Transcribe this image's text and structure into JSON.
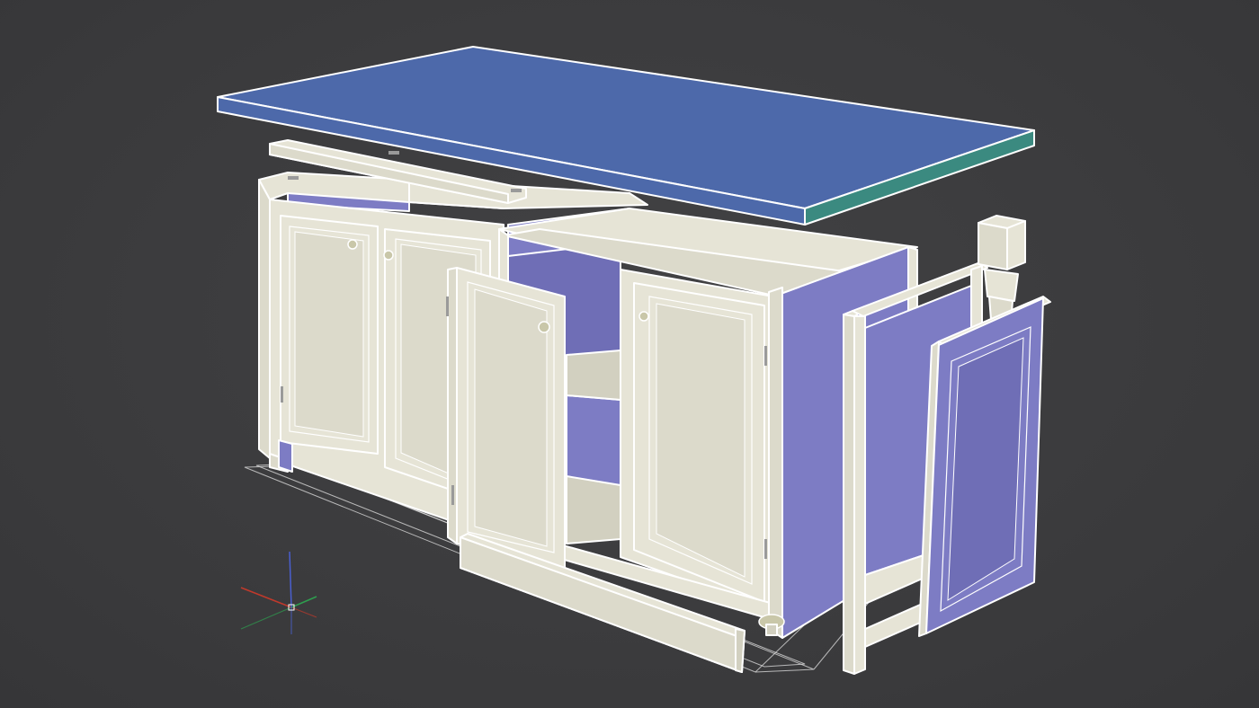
{
  "viewport": {
    "background": "#3b3b3d",
    "shading_mode": "edged-faces"
  },
  "model": {
    "parts": [
      {
        "name": "countertop",
        "color": "#4d69aa",
        "edge_color": "#3b8a80"
      },
      {
        "name": "cabinet-body",
        "color": "#e6e4d6"
      },
      {
        "name": "interior-panels",
        "color": "#7d7cc4"
      },
      {
        "name": "open-door",
        "color": "#e6e4d6"
      },
      {
        "name": "side-door-frame",
        "color": "#e6e4d6"
      },
      {
        "name": "side-door-panel",
        "color": "#7d7cc4"
      },
      {
        "name": "toe-kick",
        "color": "#e6e4d6"
      },
      {
        "name": "corner-leg-post",
        "color": "#e6e4d6"
      }
    ]
  },
  "axis_gizmo": {
    "x_color": "#c0392b",
    "y_color": "#2e9e4f",
    "z_color": "#4a5fd0"
  }
}
